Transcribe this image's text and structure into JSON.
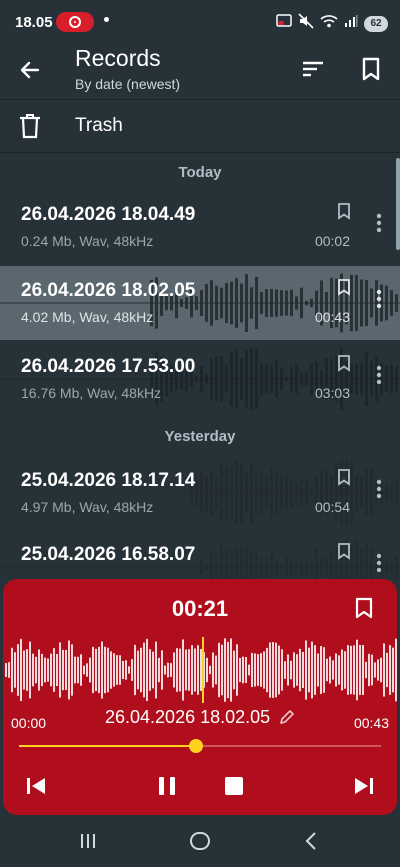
{
  "status": {
    "time": "18.05",
    "battery": "62"
  },
  "header": {
    "title": "Records",
    "subtitle": "By date (newest)"
  },
  "trash": {
    "label": "Trash"
  },
  "sections": {
    "today": "Today",
    "yesterday": "Yesterday"
  },
  "records": [
    {
      "name": "26.04.2026 18.04.49",
      "info": "0.24 Mb, Wav, 48kHz",
      "duration": "00:02"
    },
    {
      "name": "26.04.2026 18.02.05",
      "info": "4.02 Mb, Wav, 48kHz",
      "duration": "00:43"
    },
    {
      "name": "26.04.2026 17.53.00",
      "info": "16.76 Mb, Wav, 48kHz",
      "duration": "03:03"
    },
    {
      "name": "25.04.2026 18.17.14",
      "info": "4.97 Mb, Wav, 48kHz",
      "duration": "00:54"
    },
    {
      "name": "25.04.2026 16.58.07",
      "info": "",
      "duration": ""
    }
  ],
  "player": {
    "current_time": "00:21",
    "start_time": "00:00",
    "end_time": "00:43",
    "record_name": "26.04.2026 18.02.05",
    "progress": 0.49
  },
  "colors": {
    "background": "#263238",
    "player": "#b00e1c",
    "accent": "#ffd21f",
    "active_row": "#5a676e"
  }
}
